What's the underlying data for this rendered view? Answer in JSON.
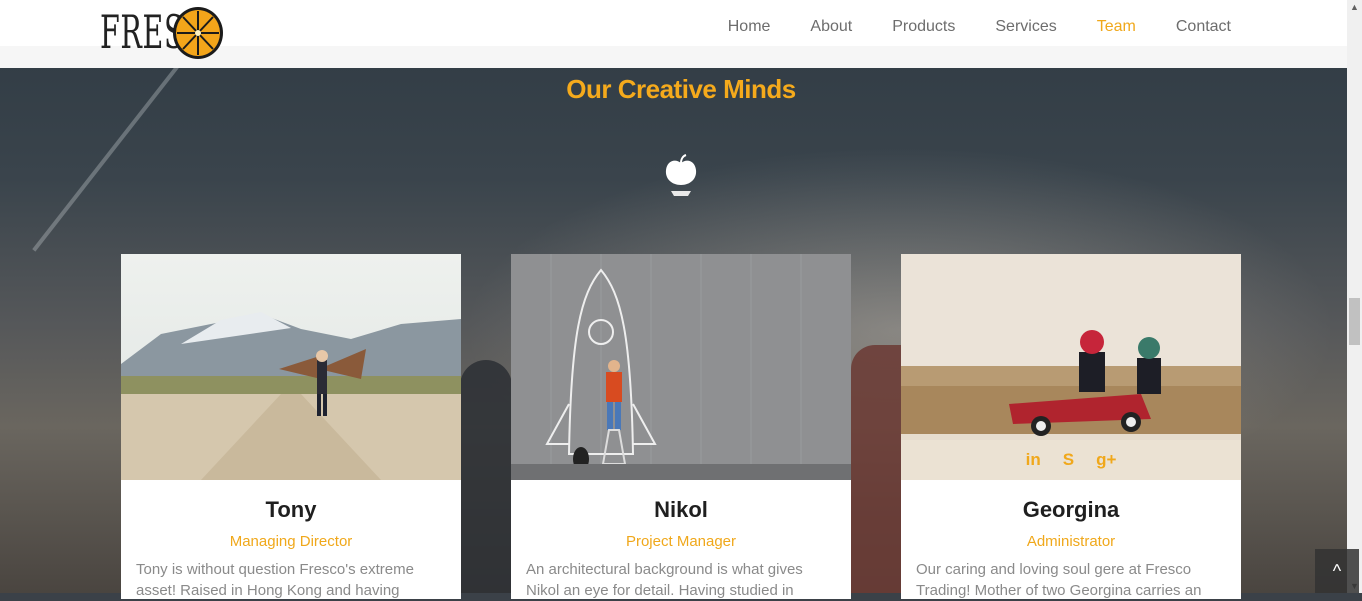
{
  "brand": {
    "logo_text": "FRESC"
  },
  "nav": {
    "items": [
      {
        "label": "Home"
      },
      {
        "label": "About"
      },
      {
        "label": "Products"
      },
      {
        "label": "Services"
      },
      {
        "label": "Team"
      },
      {
        "label": "Contact"
      }
    ],
    "active": "Team"
  },
  "section": {
    "title": "Our Creative Minds",
    "icon": "apple-icon"
  },
  "team": [
    {
      "name": "Tony",
      "role": "Managing Director",
      "bio": "Tony is without question Fresco's extreme asset! Raised in Hong Kong and having"
    },
    {
      "name": "Nikol",
      "role": "Project Manager",
      "bio": "An architectural background is what gives Nikol an eye for detail. Having studied in"
    },
    {
      "name": "Georgina",
      "role": "Administrator",
      "bio": "Our caring and loving soul gere at Fresco Trading! Mother of two Georgina carries an",
      "socials": [
        {
          "icon": "linkedin-icon",
          "glyph": "in"
        },
        {
          "icon": "skype-icon",
          "glyph": "S"
        },
        {
          "icon": "google-plus-icon",
          "glyph": "g+"
        }
      ]
    }
  ],
  "colors": {
    "accent": "#f5aa1c",
    "header_bg": "#ffffff",
    "nav_text": "#6d6d6d"
  },
  "scroll_top": {
    "icon": "chevron-up-icon",
    "glyph": "^"
  }
}
